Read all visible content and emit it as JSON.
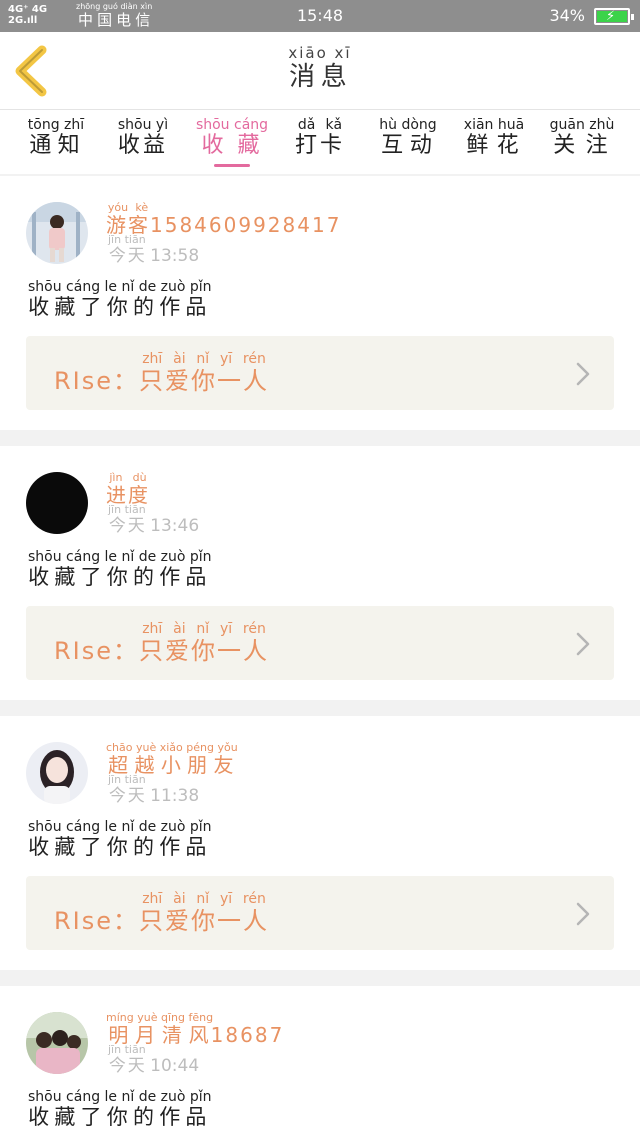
{
  "status_bar": {
    "signal": "4G⁺ 4G\n2G.ıll",
    "carrier": "中国电信",
    "carrier_pinyin": "zhōng guó diàn xìn",
    "time": "15:48",
    "battery": "34%"
  },
  "header": {
    "title": "消息",
    "title_pinyin": "xiāo xī"
  },
  "tabs": [
    {
      "label": "通知",
      "pinyin": "tōng zhī"
    },
    {
      "label": "收益",
      "pinyin": "shōu yì"
    },
    {
      "label": "收藏",
      "pinyin": "shōu cáng",
      "active": true
    },
    {
      "label": "打卡",
      "pinyin": "dǎ kǎ"
    },
    {
      "label": "互动",
      "pinyin": "hù dòng"
    },
    {
      "label": "鲜花",
      "pinyin": "xiān huā"
    },
    {
      "label": "关注",
      "pinyin": "guān zhù"
    }
  ],
  "messages": [
    {
      "name": "游客",
      "name_pinyin": "yóu kè",
      "name_suffix": "1584609928417",
      "day": "今天",
      "day_pinyin": "jīn tiān",
      "time": "13:58",
      "action": "收藏了你的作品",
      "action_pinyin": "shōu cáng le nǐ de zuò pǐn",
      "work_prefix": "RIse：",
      "work_title": "只爱你一人",
      "work_pinyin": "zhī ài nǐ yī rén"
    },
    {
      "name": "进度",
      "name_pinyin": "jìn dù",
      "name_suffix": "",
      "day": "今天",
      "day_pinyin": "jīn tiān",
      "time": "13:46",
      "action": "收藏了你的作品",
      "action_pinyin": "shōu cáng le nǐ de zuò pǐn",
      "work_prefix": "RIse：",
      "work_title": "只爱你一人",
      "work_pinyin": "zhī ài nǐ yī rén"
    },
    {
      "name": "超越小朋友",
      "name_pinyin": "chāo yuè xiǎo péng yǒu",
      "name_suffix": "",
      "day": "今天",
      "day_pinyin": "jīn tiān",
      "time": "11:38",
      "action": "收藏了你的作品",
      "action_pinyin": "shōu cáng le nǐ de zuò pǐn",
      "work_prefix": "RIse：",
      "work_title": "只爱你一人",
      "work_pinyin": "zhī ài nǐ yī rén"
    },
    {
      "name": "明月清风",
      "name_pinyin": "míng yuè qīng fēng",
      "name_suffix": "18687",
      "day": "今天",
      "day_pinyin": "jīn tiān",
      "time": "10:44",
      "action": "收藏了你的作品",
      "action_pinyin": "shōu cáng le nǐ de zuò pǐn",
      "work_prefix": "",
      "work_title": "",
      "work_pinyin": ""
    }
  ],
  "colors": {
    "accent_pink": "#e36a9e",
    "name_orange": "#e89262",
    "back_yellow": "#f3c644",
    "work_bg": "#f4f3ed"
  }
}
